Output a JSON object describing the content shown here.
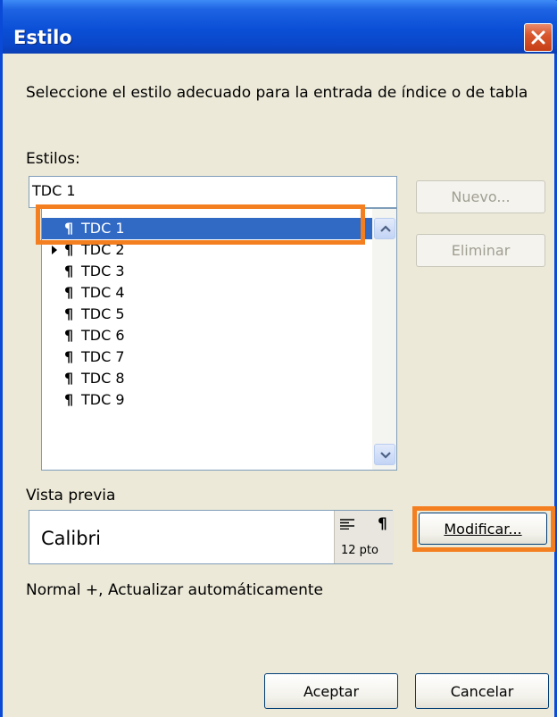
{
  "window": {
    "title": "Estilo",
    "close_icon": "close-icon"
  },
  "instruction": "Seleccione el estilo adecuado para la entrada de índice o de tabla",
  "styles": {
    "label": "Estilos:",
    "input_value": "TDC 1",
    "items": [
      {
        "mark": "¶",
        "label": "TDC 1",
        "selected": true
      },
      {
        "mark": "¶",
        "label": "TDC 2",
        "selected": false
      },
      {
        "mark": "¶",
        "label": "TDC 3",
        "selected": false
      },
      {
        "mark": "¶",
        "label": "TDC 4",
        "selected": false
      },
      {
        "mark": "¶",
        "label": "TDC 5",
        "selected": false
      },
      {
        "mark": "¶",
        "label": "TDC 6",
        "selected": false
      },
      {
        "mark": "¶",
        "label": "TDC 7",
        "selected": false
      },
      {
        "mark": "¶",
        "label": "TDC 8",
        "selected": false
      },
      {
        "mark": "¶",
        "label": "TDC 9",
        "selected": false
      }
    ]
  },
  "buttons": {
    "nuevo": "Nuevo...",
    "eliminar": "Eliminar",
    "modificar": "Modificar...",
    "aceptar": "Aceptar",
    "cancelar": "Cancelar"
  },
  "preview": {
    "label": "Vista previa",
    "font": "Calibri",
    "size": "12 pto",
    "para_mark": "¶"
  },
  "description": "Normal +, Actualizar automáticamente",
  "colors": {
    "titlebar": "#0a4fd6",
    "selection": "#316ac5",
    "highlight": "#f47f20",
    "dialog_bg": "#ece9d8"
  }
}
